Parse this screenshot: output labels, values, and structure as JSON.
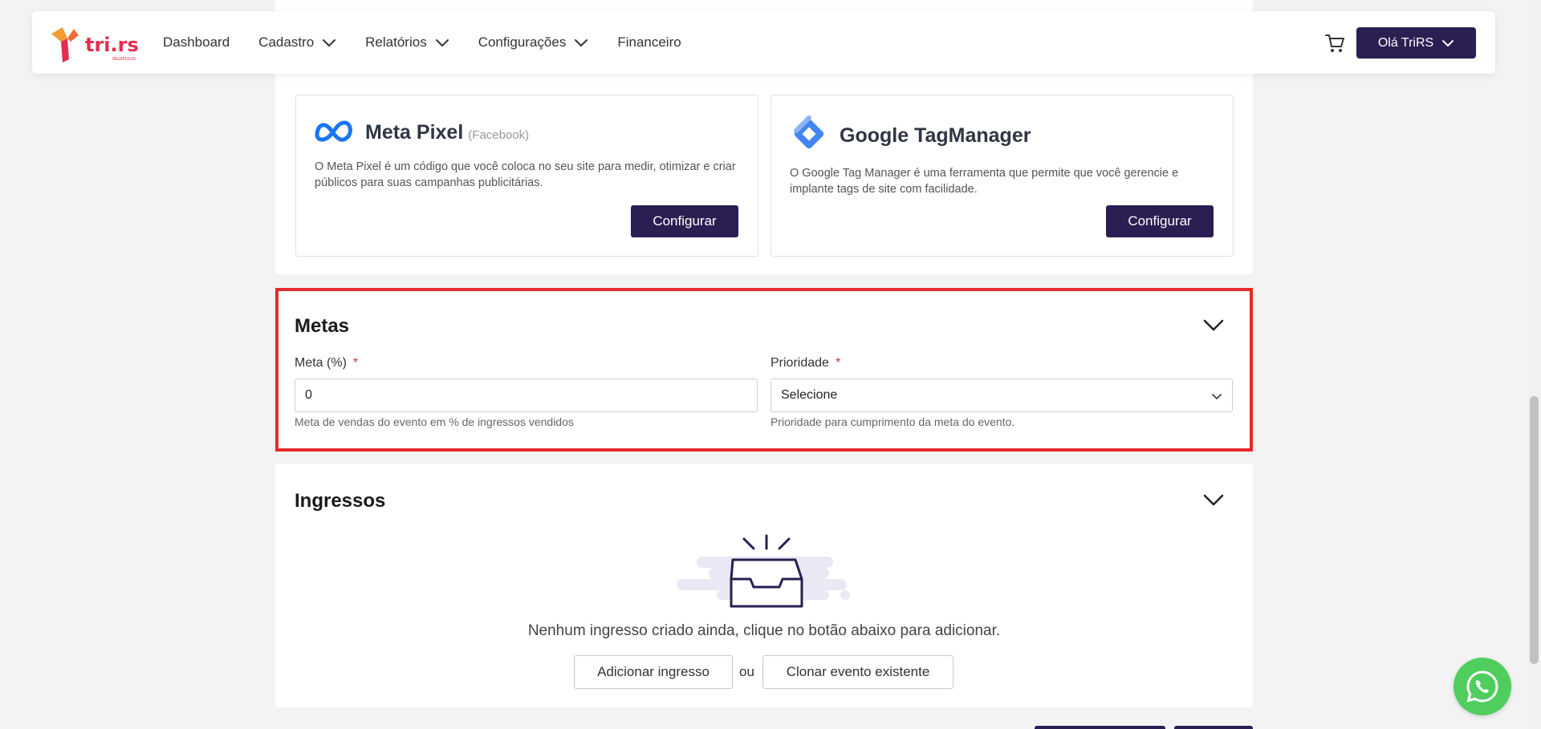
{
  "nav": {
    "brand": "tri.rs",
    "brand_sub": "INGRESSOS",
    "items": [
      {
        "label": "Dashboard",
        "dropdown": false
      },
      {
        "label": "Cadastro",
        "dropdown": true
      },
      {
        "label": "Relatórios",
        "dropdown": true
      },
      {
        "label": "Configurações",
        "dropdown": true
      },
      {
        "label": "Financeiro",
        "dropdown": false
      }
    ],
    "cart_icon": "cart-icon",
    "user_label": "Olá TriRS"
  },
  "integrations": {
    "meta": {
      "title": "Meta Pixel",
      "subtitle": "(Facebook)",
      "description": "O Meta Pixel é um código que você coloca no seu site para medir, otimizar e criar públicos para suas campanhas publicitárias.",
      "button": "Configurar"
    },
    "gtm": {
      "title": "Google TagManager",
      "description": "O Google Tag Manager é uma ferramenta que permite que você gerencie e implante tags de site com facilidade.",
      "button": "Configurar"
    }
  },
  "metas": {
    "title": "Metas",
    "meta_field": {
      "label": "Meta (%)",
      "required_mark": "*",
      "value": "0",
      "help": "Meta de vendas do evento em % de ingressos vendidos"
    },
    "priority_field": {
      "label": "Prioridade",
      "required_mark": "*",
      "selected": "Selecione",
      "help": "Prioridade para cumprimento da meta do evento."
    }
  },
  "ingressos": {
    "title": "Ingressos",
    "empty_message": "Nenhum ingresso criado ainda, clique no botão abaixo para adicionar.",
    "add_button": "Adicionar ingresso",
    "or_text": "ou",
    "clone_button": "Clonar evento existente"
  },
  "colors": {
    "primary": "#2a1e52",
    "highlight_border": "#e32b2b",
    "whatsapp": "#4fce5d"
  }
}
